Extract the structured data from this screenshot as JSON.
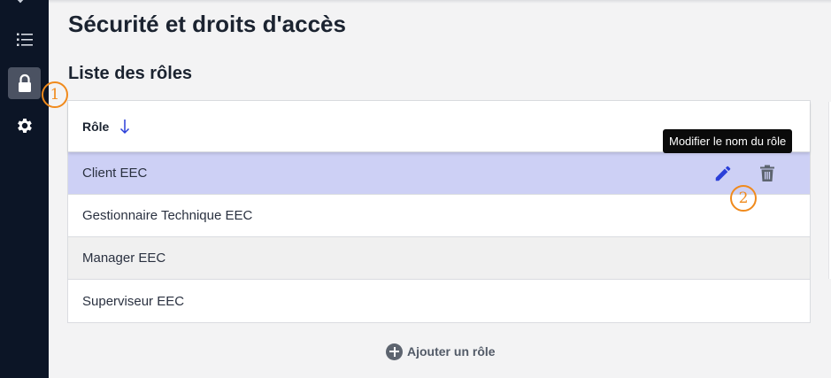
{
  "page": {
    "title": "Sécurité et droits d'accès",
    "section_title": "Liste des rôles"
  },
  "sidebar": {
    "items": [
      {
        "name": "list-icon",
        "active": false
      },
      {
        "name": "lock-icon",
        "active": true
      },
      {
        "name": "gear-icon",
        "active": false
      }
    ]
  },
  "table": {
    "header": {
      "label": "Rôle",
      "sort": "descending"
    },
    "rows": [
      {
        "label": "Client EEC",
        "state": "selected"
      },
      {
        "label": "Gestionnaire Technique EEC",
        "state": "normal"
      },
      {
        "label": "Manager EEC",
        "state": "hover"
      },
      {
        "label": "Superviseur EEC",
        "state": "normal"
      }
    ]
  },
  "row_actions": {
    "edit_icon": "pencil-icon",
    "delete_icon": "trash-icon"
  },
  "tooltip": {
    "text": "Modifier le nom du rôle"
  },
  "add_button": {
    "label": "Ajouter un rôle",
    "icon": "plus-circle-icon"
  },
  "callouts": {
    "first": "1",
    "second": "2"
  },
  "colors": {
    "sidebar_bg": "#0c1526",
    "selected_row": "#cdd0f5",
    "accent_blue": "#2b3fd8",
    "callout_orange": "#f08a1c"
  }
}
